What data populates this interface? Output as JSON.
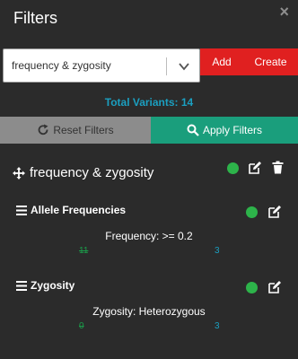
{
  "header": {
    "title": "Filters",
    "close_label": "×"
  },
  "toolbar": {
    "selected_filter": "frequency & zygosity",
    "add_label": "Add",
    "create_label": "Create"
  },
  "summary": {
    "total_variants": "Total Variants: 14"
  },
  "actions": {
    "reset_label": "Reset Filters",
    "apply_label": "Apply Filters"
  },
  "group": {
    "name": "frequency & zygosity",
    "status_color": "#2db34a",
    "filters": [
      {
        "name": "Allele Frequencies",
        "description": "Frequency: >= 0.2",
        "count_before": "11",
        "count_after": "3"
      },
      {
        "name": "Zygosity",
        "description": "Zygosity: Heterozygous",
        "count_before": "0",
        "count_after": "3"
      }
    ]
  },
  "colors": {
    "background": "#2b2b2b",
    "danger": "#e02020",
    "apply": "#1a9e7c",
    "reset": "#8c8c8c",
    "accent": "#1b9fc0",
    "status_ok": "#2db34a"
  },
  "icons": [
    "close-icon",
    "chevron-down-icon",
    "refresh-icon",
    "search-icon",
    "move-icon",
    "edit-icon",
    "trash-icon",
    "bars-icon"
  ]
}
